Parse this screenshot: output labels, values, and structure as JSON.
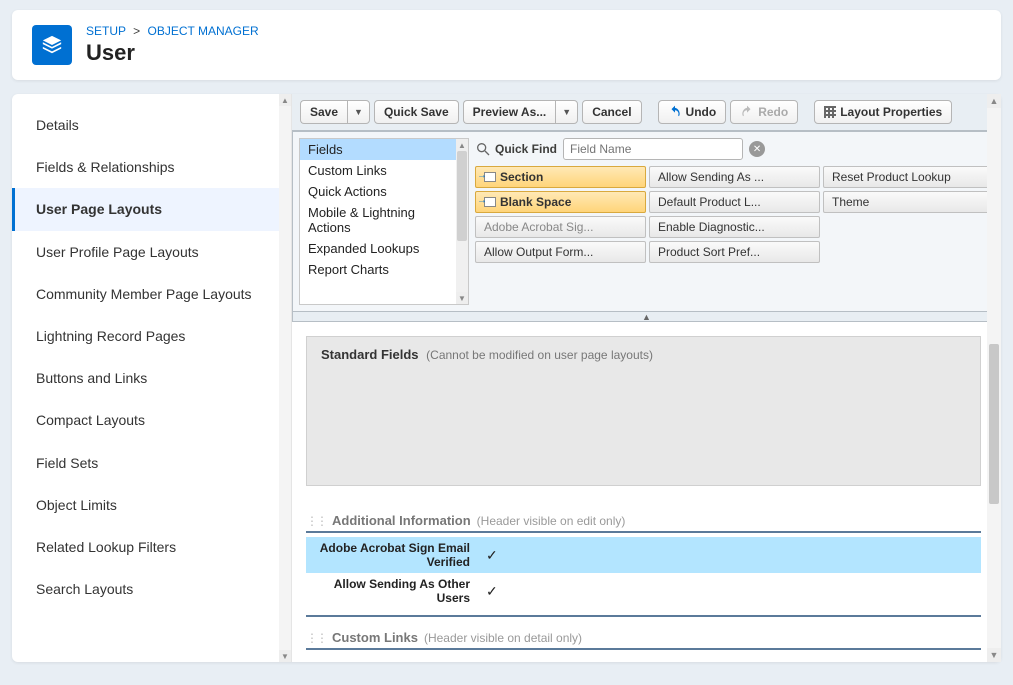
{
  "breadcrumb": {
    "setup": "SETUP",
    "object_manager": "OBJECT MANAGER"
  },
  "header": {
    "title": "User"
  },
  "sidebar": {
    "items": [
      {
        "label": "Details"
      },
      {
        "label": "Fields & Relationships"
      },
      {
        "label": "User Page Layouts"
      },
      {
        "label": "User Profile Page Layouts"
      },
      {
        "label": "Community Member Page Layouts"
      },
      {
        "label": "Lightning Record Pages"
      },
      {
        "label": "Buttons and Links"
      },
      {
        "label": "Compact Layouts"
      },
      {
        "label": "Field Sets"
      },
      {
        "label": "Object Limits"
      },
      {
        "label": "Related Lookup Filters"
      },
      {
        "label": "Search Layouts"
      }
    ],
    "active_index": 2
  },
  "toolbar": {
    "save": "Save",
    "quicksave": "Quick Save",
    "previewas": "Preview As...",
    "cancel": "Cancel",
    "undo": "Undo",
    "redo": "Redo",
    "layout_properties": "Layout Properties"
  },
  "palette": {
    "categories": [
      "Fields",
      "Custom Links",
      "Quick Actions",
      "Mobile & Lightning Actions",
      "Expanded Lookups",
      "Report Charts"
    ],
    "selected_category_index": 0,
    "quickfind_label": "Quick Find",
    "quickfind_placeholder": "Field Name",
    "tiles": [
      {
        "label": "Section",
        "kind": "section"
      },
      {
        "label": "Allow Sending As ...",
        "kind": "normal"
      },
      {
        "label": "Reset Product Lookup",
        "kind": "normal"
      },
      {
        "label": "Blank Space",
        "kind": "blank"
      },
      {
        "label": "Default Product L...",
        "kind": "normal"
      },
      {
        "label": "Theme",
        "kind": "normal"
      },
      {
        "label": "Adobe Acrobat Sig...",
        "kind": "disabled"
      },
      {
        "label": "Enable Diagnostic...",
        "kind": "normal"
      },
      {
        "label": "",
        "kind": "empty"
      },
      {
        "label": "Allow Output Form...",
        "kind": "normal"
      },
      {
        "label": "Product Sort Pref...",
        "kind": "normal"
      },
      {
        "label": "",
        "kind": "empty"
      }
    ]
  },
  "canvas": {
    "standard_fields_title": "Standard Fields",
    "standard_fields_note": "(Cannot be modified on user page layouts)",
    "additional_info_title": "Additional Information",
    "additional_info_note": "(Header visible on edit only)",
    "field_rows": [
      {
        "label": "Adobe Acrobat Sign Email Verified",
        "checked": true,
        "highlight": true
      },
      {
        "label": "Allow Sending As Other Users",
        "checked": true,
        "highlight": false
      }
    ],
    "custom_links_title": "Custom Links",
    "custom_links_note": "(Header visible on detail only)"
  }
}
